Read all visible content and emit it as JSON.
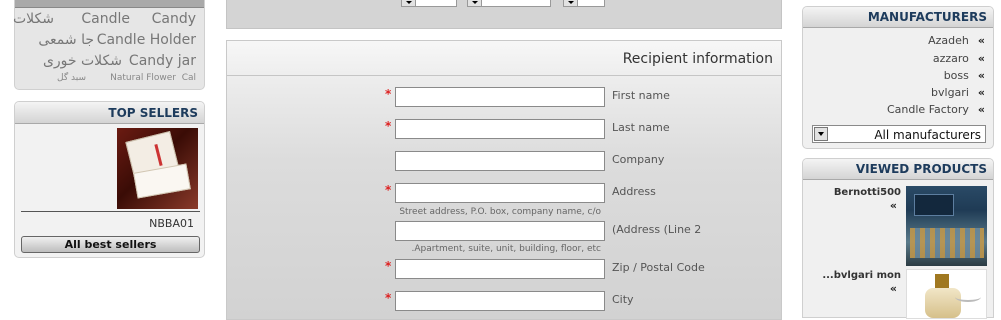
{
  "tag_cloud": [
    {
      "text": "شکلات"
    },
    {
      "text": "Candle"
    },
    {
      "text": "Candy"
    },
    {
      "text": "جا شمعی"
    },
    {
      "text": "Candle Holder"
    },
    {
      "text": "شکلات خوری"
    },
    {
      "text": "Candy jar"
    },
    {
      "text": "سبد گل"
    },
    {
      "text": "Natural Flower"
    },
    {
      "text": "Cal"
    }
  ],
  "top_sellers": {
    "title": "TOP SELLERS",
    "product_sku": "NBBA01",
    "all_button": "All best sellers"
  },
  "recipient": {
    "title": "Recipient information",
    "fields": [
      {
        "label": "First name",
        "required": "*",
        "value": ""
      },
      {
        "label": "Last name",
        "required": "*",
        "value": ""
      },
      {
        "label": "Company",
        "required": "",
        "value": ""
      },
      {
        "label": "Address",
        "required": "*",
        "value": "",
        "hint": "Street address, P.O. box, company name, c/o"
      },
      {
        "label": "(Address (Line 2",
        "required": "",
        "value": "",
        "hint": ".Apartment, suite, unit, building, floor, etc"
      },
      {
        "label": "Zip / Postal Code",
        "required": "*",
        "value": ""
      },
      {
        "label": "City",
        "required": "*",
        "value": ""
      }
    ]
  },
  "manufacturers": {
    "title": "MANUFACTURERS",
    "items": [
      "Azadeh",
      "azzaro",
      "boss",
      "bvlgari",
      "Candle Factory"
    ],
    "arrow_glyph": "«",
    "select_value": "All manufacturers"
  },
  "viewed_products": {
    "title": "VIEWED PRODUCTS",
    "items": [
      {
        "name": "Bernotti500",
        "arrow": "«"
      },
      {
        "name": "...bvlgari mon",
        "arrow": "«"
      }
    ]
  },
  "colors": {
    "header_text": "#1d3b5c",
    "required_star": "#dd2222"
  }
}
